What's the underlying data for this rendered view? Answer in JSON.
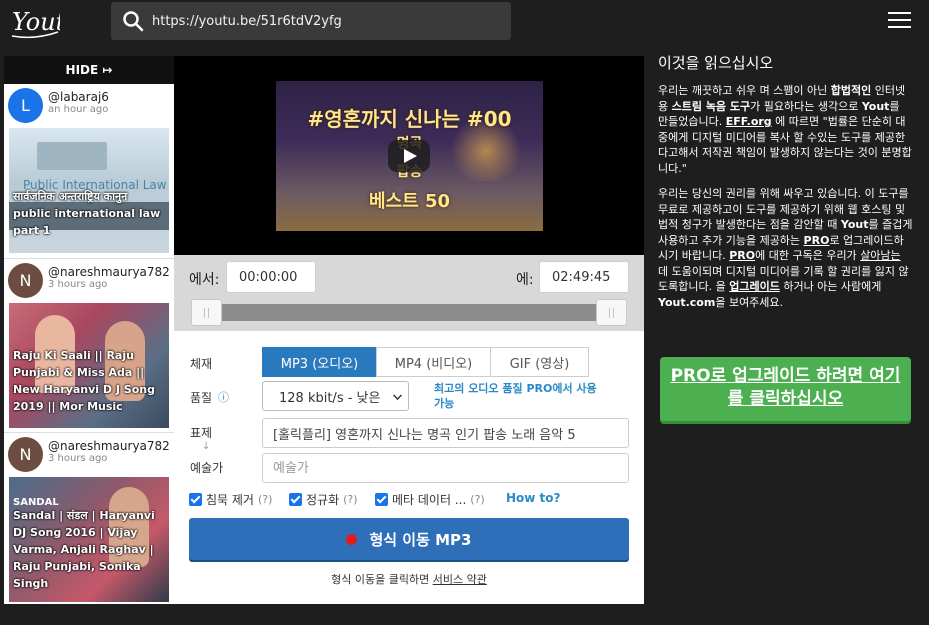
{
  "header": {
    "logo_text": "Yout",
    "url": "https://youtu.be/51r6tdV2yfg"
  },
  "feed": {
    "hide_label": "HIDE ↦",
    "items": [
      {
        "initial": "L",
        "avatar_color": "#1a73e8",
        "username": "@labaraj6",
        "time": "an hour ago",
        "thumb_caption": "Public International Law",
        "title": "सार्वजनिक अन्तराष्ट्रिय कानुन public international law part 1"
      },
      {
        "initial": "N",
        "avatar_color": "#6d4c41",
        "username": "@nareshmaurya782",
        "time": "3 hours ago",
        "title": "Raju Ki Saali || Raju Punjabi & Miss Ada || New Haryanvi D J Song 2019 || Mor Music"
      },
      {
        "initial": "N",
        "avatar_color": "#6d4c41",
        "username": "@nareshmaurya782",
        "time": "3 hours ago",
        "thumb_caption": "SANDAL",
        "title": "Sandal | संडल | Haryanvi DJ Song 2016 | Vijay Varma, Anjali Raghav | Raju Punjabi, Sonika Singh"
      }
    ]
  },
  "video": {
    "thumb_line1": "#영혼까지 신나는 #00",
    "thumb_line2": "명곡",
    "thumb_line3": "팝송",
    "thumb_line4": "베스트 50"
  },
  "range": {
    "from_label": "에서:",
    "from_value": "00:00:00",
    "to_label": "에:",
    "to_value": "02:49:45"
  },
  "form": {
    "format_label": "체재",
    "formats": [
      "MP3 (오디오)",
      "MP4 (비디오)",
      "GIF (영상)"
    ],
    "quality_label": "품질",
    "quality_value": "128 kbit/s - 낮은",
    "pro_note": "최고의 오디오 품질 PRO에서 사용 가능",
    "title_label": "표제",
    "title_value": "[홀릭플리] 영혼까지 신나는 명곡 인기 팝송 노래 음악 5",
    "artist_label": "예술가",
    "artist_placeholder": "예술가",
    "checkbox_silence": "침묵 제거",
    "checkbox_normalize": "정규화",
    "checkbox_metadata": "메타 데이터 ...",
    "question_mark": "(?)",
    "howto": "How to?",
    "convert_label": "형식 이동 MP3",
    "terms_text": "형식 이동을 클릭하면 ",
    "terms_link": "서비스 약관"
  },
  "info": {
    "heading": "이것을 읽으십시오",
    "p1_a": "우리는 깨끗하고 쉬우 며 스팸이 아닌 ",
    "p1_b": "합법적인",
    "p1_c": " 인터넷 용 ",
    "p1_d": "스트림 녹음 도구",
    "p1_e": "가 필요하다는 생각으로 ",
    "p1_f": "Yout",
    "p1_g": "를 만들었습니다. ",
    "p1_h": "EFF.org",
    "p1_i": " 에 따르면 \"법률은 단순히 대중에게 디지털 미디어를 복사 할 수있는 도구를 제공한다고해서 저작권 책임이 발생하지 않는다는 것이 분명합니다.\"",
    "p2_a": "우리는 당신의 권리를 위해 싸우고 있습니다. 이 도구를 무료로 제공하고이 도구를 제공하기 위해 웹 호스팅 및 법적 청구가 발생한다는 점을 감안할 때 ",
    "p2_b": "Yout",
    "p2_c": "를 즐겁게 사용하고 추가 기능을 제공하는 ",
    "p2_d": "PRO",
    "p2_e": "로 업그레이드하시기 바랍니다. ",
    "p2_f": "PRO",
    "p2_g": "에 대한 구독은 우리가 ",
    "p2_h": "살아남는",
    "p2_i": " 데 도움이되며 디지털 미디어를 기록 할 권리를 잃지 않도록합니다. 을 ",
    "p2_j": "업그레이드",
    "p2_k": " 하거나 아는 사람에게 ",
    "p2_l": "Yout.com",
    "p2_m": "을 보여주세요.",
    "pro_button": "PRO로 업그레이드 하려면 여기 를 클릭하십시오"
  },
  "colors": {
    "background": "#1e1e1e",
    "accent_blue": "#2a7ac0",
    "convert_button": "#2d6fb8",
    "pro_green": "#4caf50",
    "record_red": "#e01b1b"
  }
}
